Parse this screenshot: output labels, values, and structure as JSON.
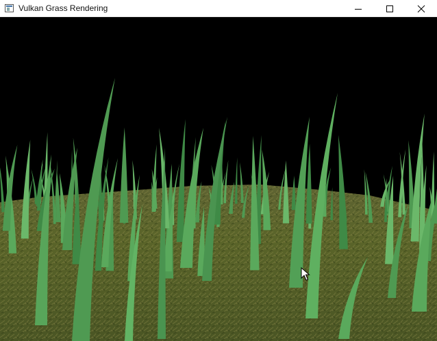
{
  "window": {
    "title": "Vulkan Grass Rendering",
    "controls": {
      "minimize_icon": "minimize-icon",
      "maximize_icon": "maximize-icon",
      "close_icon": "close-icon"
    }
  },
  "scene": {
    "background_color": "#000000",
    "ground_colors": [
      "#6e6a36",
      "#556126",
      "#3f4a1c",
      "#7c7a48"
    ],
    "blade_colors": [
      "#4f9a52",
      "#5aa95c",
      "#3f8a46",
      "#6bb86a"
    ]
  }
}
